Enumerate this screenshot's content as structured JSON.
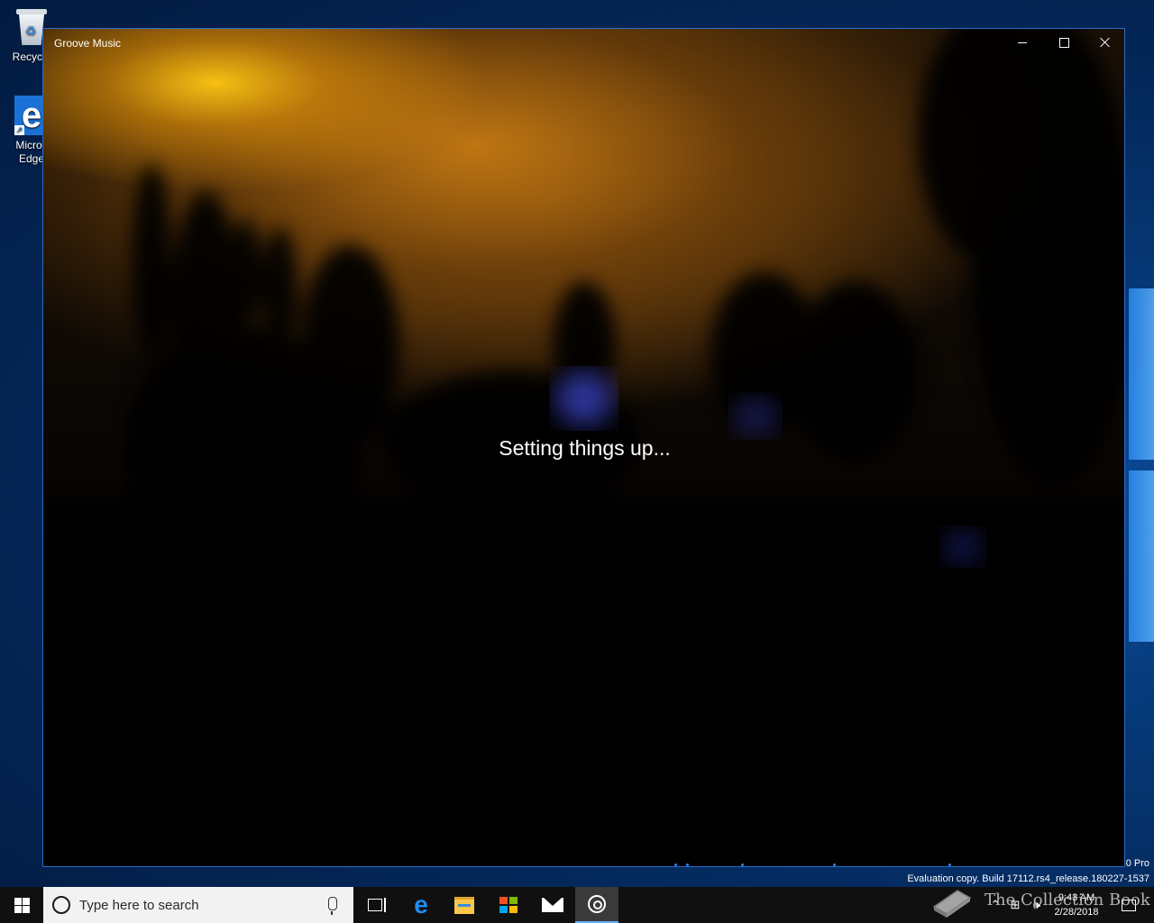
{
  "desktop": {
    "icons": [
      {
        "label": "Recycle"
      },
      {
        "label": "Micros Edge"
      }
    ]
  },
  "window": {
    "title": "Groove Music",
    "status": "Setting things up..."
  },
  "watermark": {
    "edition": "0 Pro",
    "build": "Evaluation copy. Build 17112.rs4_release.180227-1537"
  },
  "taskbar": {
    "search_placeholder": "Type here to search",
    "clock_time": "9:43 AM",
    "clock_date": "2/28/2018",
    "pinned": [
      "task-view",
      "edge",
      "file-explorer",
      "store",
      "mail",
      "groove-music"
    ]
  },
  "overlay": {
    "brand": "The Collection Book"
  },
  "colors": {
    "accent": "#2d6bc5",
    "taskbar": "#101010",
    "edge_blue": "#1f8ef1"
  }
}
